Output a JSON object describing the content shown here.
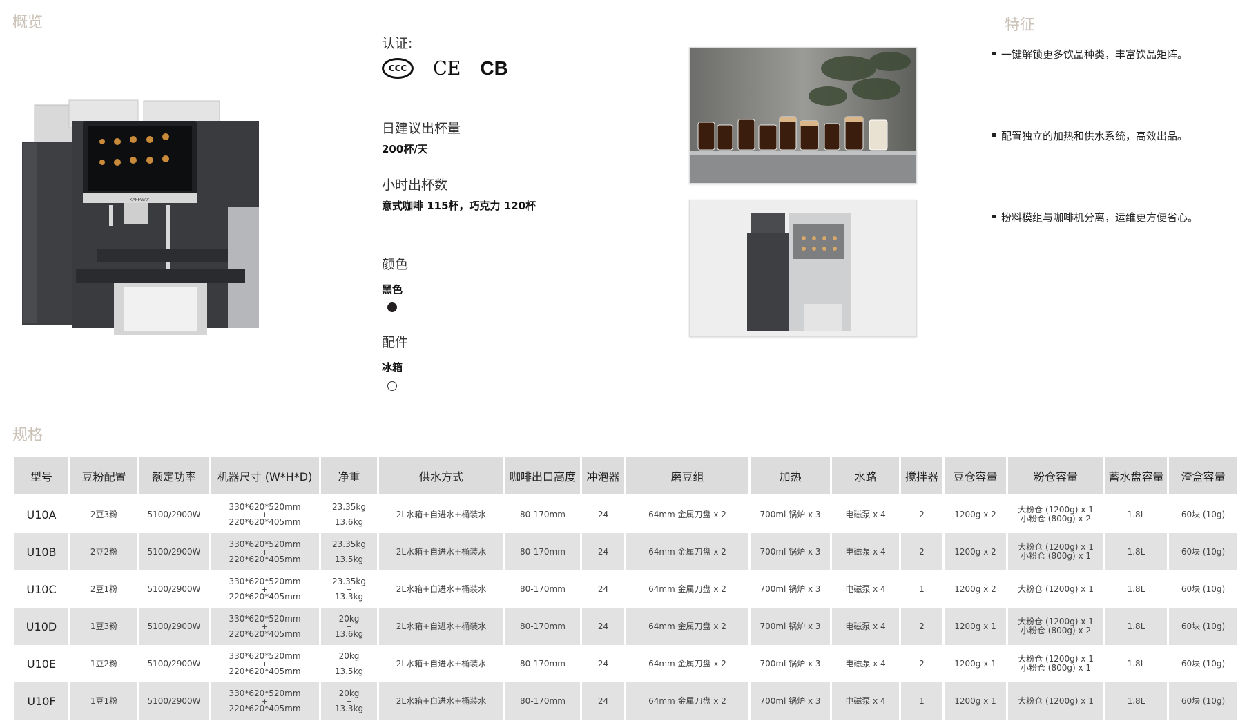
{
  "sections": {
    "overview": "概览",
    "features": "特征",
    "specs": "规格"
  },
  "info": {
    "cert_label": "认证:",
    "certs": [
      "CCC",
      "CE",
      "CB"
    ],
    "daily_label": "日建议出杯量",
    "daily_value": "200杯/天",
    "hourly_label": "小时出杯数",
    "hourly_value": "意式咖啡 115杯，巧克力 120杯",
    "color_label": "颜色",
    "color_value": "黑色",
    "accessory_label": "配件",
    "accessory_value": "冰箱",
    "product_brand": "KAFFWAY"
  },
  "features": [
    "一键解锁更多饮品种类，丰富饮品矩阵。",
    "配置独立的加热和供水系统，高效出品。",
    "粉料模组与咖啡机分离，运维更方便省心。"
  ],
  "colors": {
    "section_title": "#cbc3b8",
    "header_bg": "#dcdcdc",
    "row_alt": "#e2e2e2",
    "machine": "#3a3b3e",
    "swatch_black": "#231f20"
  },
  "table": {
    "headers": [
      "型号",
      "豆粉配置",
      "额定功率",
      "机器尺寸 (W*H*D)",
      "净重",
      "供水方式",
      "咖啡出口高度",
      "冲泡器",
      "磨豆组",
      "加热",
      "水路",
      "搅拌器",
      "豆仓容量",
      "粉仓容量",
      "蓄水盘容量",
      "渣盒容量"
    ],
    "rows": [
      {
        "model": "U10A",
        "config": "2豆3粉",
        "power": "5100/2900W",
        "size_top": "330*620*520mm",
        "size_bottom": "220*620*405mm",
        "weight_top": "23.35kg",
        "weight_bottom": "13.6kg",
        "water": "2L水箱+自进水+桶装水",
        "height": "80-170mm",
        "brewer": "24",
        "grinder": "64mm 金属刀盘 x 2",
        "heating": "700ml 锅炉 x 3",
        "pump": "电磁泵 x 4",
        "mixer": "2",
        "bean": "1200g x 2",
        "powder_top": "大粉仓 (1200g) x 1",
        "powder_bottom": "小粉仓 (800g) x 2",
        "tray": "1.8L",
        "waste": "60块 (10g)"
      },
      {
        "model": "U10B",
        "config": "2豆2粉",
        "power": "5100/2900W",
        "size_top": "330*620*520mm",
        "size_bottom": "220*620*405mm",
        "weight_top": "23.35kg",
        "weight_bottom": "13.5kg",
        "water": "2L水箱+自进水+桶装水",
        "height": "80-170mm",
        "brewer": "24",
        "grinder": "64mm 金属刀盘 x 2",
        "heating": "700ml 锅炉 x 3",
        "pump": "电磁泵 x 4",
        "mixer": "2",
        "bean": "1200g x 2",
        "powder_top": "大粉仓 (1200g) x 1",
        "powder_bottom": "小粉仓 (800g) x 1",
        "tray": "1.8L",
        "waste": "60块 (10g)"
      },
      {
        "model": "U10C",
        "config": "2豆1粉",
        "power": "5100/2900W",
        "size_top": "330*620*520mm",
        "size_bottom": "220*620*405mm",
        "weight_top": "23.35kg",
        "weight_bottom": "13.3kg",
        "water": "2L水箱+自进水+桶装水",
        "height": "80-170mm",
        "brewer": "24",
        "grinder": "64mm 金属刀盘 x 2",
        "heating": "700ml 锅炉 x 3",
        "pump": "电磁泵 x 4",
        "mixer": "1",
        "bean": "1200g x 2",
        "powder_top": "大粉仓 (1200g) x 1",
        "powder_bottom": "",
        "tray": "1.8L",
        "waste": "60块 (10g)"
      },
      {
        "model": "U10D",
        "config": "1豆3粉",
        "power": "5100/2900W",
        "size_top": "330*620*520mm",
        "size_bottom": "220*620*405mm",
        "weight_top": "20kg",
        "weight_bottom": "13.6kg",
        "water": "2L水箱+自进水+桶装水",
        "height": "80-170mm",
        "brewer": "24",
        "grinder": "64mm 金属刀盘 x 2",
        "heating": "700ml 锅炉 x 3",
        "pump": "电磁泵 x 4",
        "mixer": "2",
        "bean": "1200g x 1",
        "powder_top": "大粉仓 (1200g) x 1",
        "powder_bottom": "小粉仓 (800g) x 2",
        "tray": "1.8L",
        "waste": "60块 (10g)"
      },
      {
        "model": "U10E",
        "config": "1豆2粉",
        "power": "5100/2900W",
        "size_top": "330*620*520mm",
        "size_bottom": "220*620*405mm",
        "weight_top": "20kg",
        "weight_bottom": "13.5kg",
        "water": "2L水箱+自进水+桶装水",
        "height": "80-170mm",
        "brewer": "24",
        "grinder": "64mm 金属刀盘 x 2",
        "heating": "700ml 锅炉 x 3",
        "pump": "电磁泵 x 4",
        "mixer": "2",
        "bean": "1200g x 1",
        "powder_top": "大粉仓 (1200g) x 1",
        "powder_bottom": "小粉仓 (800g) x 1",
        "tray": "1.8L",
        "waste": "60块 (10g)"
      },
      {
        "model": "U10F",
        "config": "1豆1粉",
        "power": "5100/2900W",
        "size_top": "330*620*520mm",
        "size_bottom": "220*620*405mm",
        "weight_top": "20kg",
        "weight_bottom": "13.3kg",
        "water": "2L水箱+自进水+桶装水",
        "height": "80-170mm",
        "brewer": "24",
        "grinder": "64mm 金属刀盘 x 2",
        "heating": "700ml 锅炉 x 3",
        "pump": "电磁泵 x 4",
        "mixer": "1",
        "bean": "1200g x 1",
        "powder_top": "大粉仓 (1200g) x 1",
        "powder_bottom": "",
        "tray": "1.8L",
        "waste": "60块 (10g)"
      }
    ]
  }
}
